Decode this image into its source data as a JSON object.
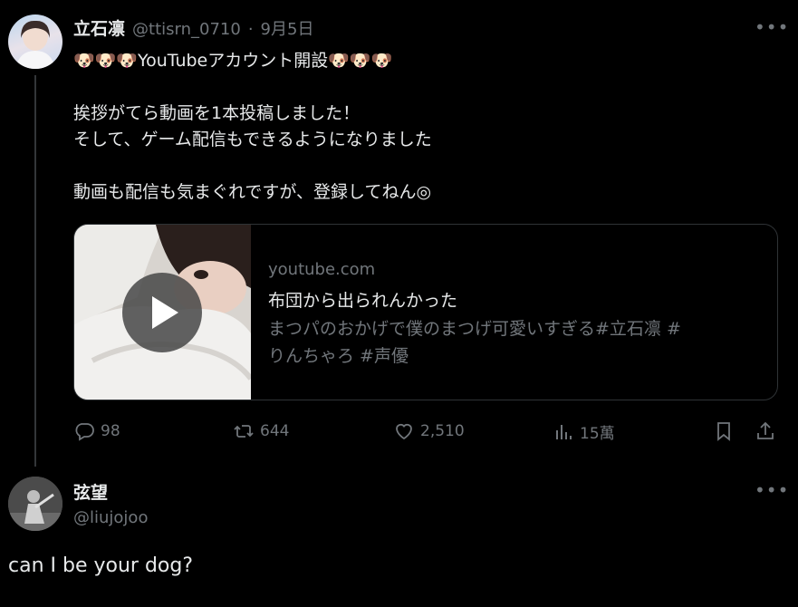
{
  "tweet": {
    "author_name": "立石凛",
    "author_handle": "@ttisrn_0710",
    "separator": "·",
    "date": "9月5日",
    "more_label": "•••",
    "headline_emoji": "🐶🐶🐶",
    "headline_text": "YouTubeアカウント開設",
    "headline_emoji_end": "🐶🐶🐶",
    "body": "挨拶がてら動画を1本投稿しました！\nそして、ゲーム配信もできるようになりました\n\n動画も配信も気まぐれですが、登録してねん◎",
    "card": {
      "domain": "youtube.com",
      "title": "布団から出られんかった",
      "description": "まつパのおかげで僕のまつげ可愛いすぎる#立石凛 #\nりんちゃろ #声優"
    },
    "actions": {
      "replies": "98",
      "retweets": "644",
      "likes": "2,510",
      "views": "15萬"
    }
  },
  "reply": {
    "author_name": "弦望",
    "author_handle": "@liujojoo",
    "more_label": "•••",
    "text": "can I be your dog?"
  },
  "colors": {
    "background": "#000000",
    "text_primary": "#e7e9ea",
    "text_secondary": "#71767b",
    "border": "#2f3336"
  },
  "icons": [
    "reply-icon",
    "retweet-icon",
    "like-icon",
    "views-icon",
    "bookmark-icon",
    "share-icon",
    "more-icon",
    "play-icon"
  ]
}
